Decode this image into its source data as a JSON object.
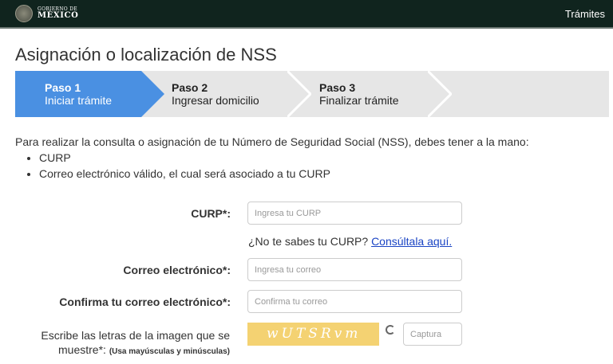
{
  "header": {
    "logo_line1": "GOBIERNO DE",
    "logo_line2": "MÉXICO",
    "nav_tramites": "Trámites"
  },
  "page_title": "Asignación o localización de NSS",
  "steps": [
    {
      "number": "Paso 1",
      "label": "Iniciar trámite",
      "active": true
    },
    {
      "number": "Paso 2",
      "label": "Ingresar domicilio",
      "active": false
    },
    {
      "number": "Paso 3",
      "label": "Finalizar trámite",
      "active": false
    }
  ],
  "intro": {
    "text": "Para realizar la consulta o asignación de tu Número de Seguridad Social (NSS), debes tener a la mano:",
    "items": [
      "CURP",
      "Correo electrónico válido, el cual será asociado a tu CURP"
    ]
  },
  "form": {
    "curp_label": "CURP*:",
    "curp_placeholder": "Ingresa tu CURP",
    "curp_help": "¿No te sabes tu CURP?",
    "curp_link": "Consúltala aquí.",
    "email_label": "Correo electrónico*:",
    "email_placeholder": "Ingresa tu correo",
    "confirm_label": "Confirma tu correo electrónico*:",
    "confirm_placeholder": "Confirma tu correo",
    "captcha_label": "Escribe las letras de la imagen que se muestre*:",
    "captcha_note": "(Usa mayúsculas y minúsculas)",
    "captcha_text": "wUTSRvm",
    "captcha_placeholder": "Captura"
  },
  "colors": {
    "header": "#10241e",
    "step_active": "#4a90e2",
    "link": "#1a44c4",
    "captcha_bg": "#f4d272"
  }
}
